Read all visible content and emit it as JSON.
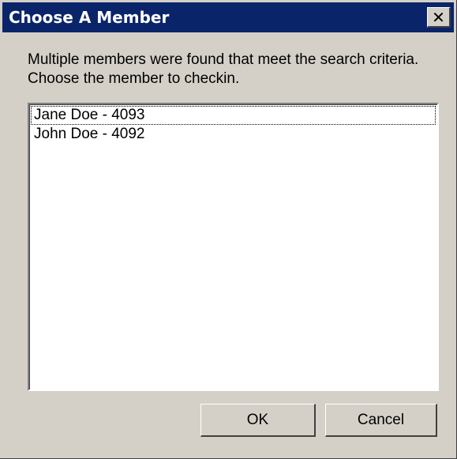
{
  "window": {
    "title": "Choose A Member",
    "close_label": "✕"
  },
  "message": "Multiple members were found that meet the search criteria. Choose the member to checkin.",
  "members": [
    {
      "label": "Jane Doe - 4093",
      "focused": true
    },
    {
      "label": "John Doe - 4092",
      "focused": false
    }
  ],
  "buttons": {
    "ok_label": "OK",
    "cancel_label": "Cancel"
  },
  "colors": {
    "titlebar": "#0a246a",
    "dialog_face": "#d4d0c8"
  }
}
